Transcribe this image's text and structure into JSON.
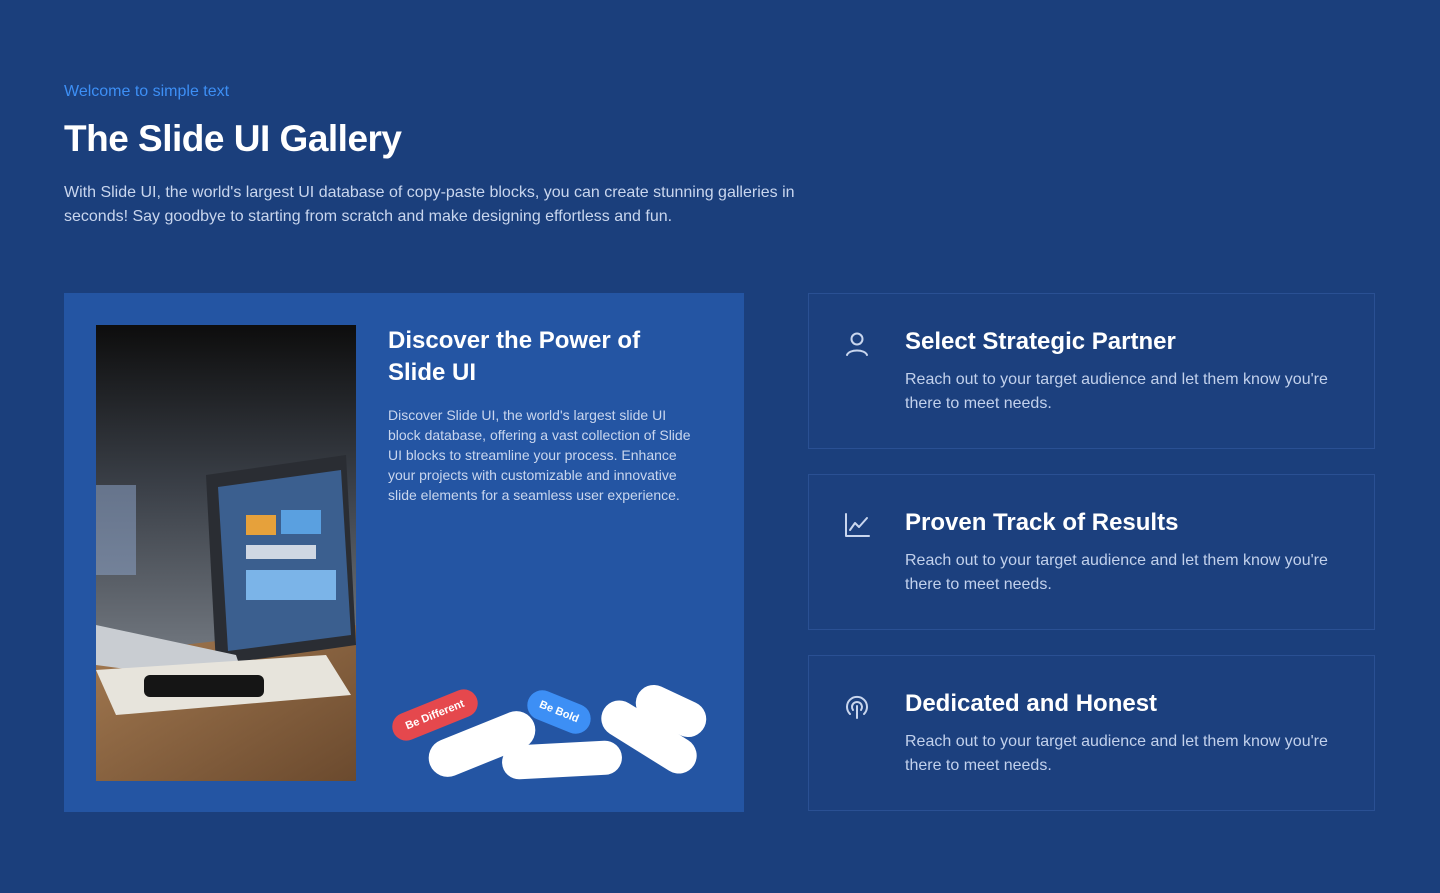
{
  "header": {
    "eyebrow": "Welcome to simple text",
    "title": "The Slide UI Gallery",
    "intro": "With Slide UI, the world's largest UI database of copy-paste blocks, you can create stunning galleries in seconds! Say goodbye to starting from scratch and make designing effortless and fun."
  },
  "hero": {
    "title": "Discover the Power of Slide UI",
    "text": "Discover Slide UI, the world's largest slide UI block database, offering a vast collection of Slide UI blocks to streamline your process. Enhance your projects with customizable and innovative slide elements for a seamless user experience.",
    "tags": [
      "Be Different",
      "Be Bold"
    ]
  },
  "features": [
    {
      "icon": "user-icon",
      "title": "Select Strategic Partner",
      "text": "Reach out to your target audience and let them know you're there to meet needs."
    },
    {
      "icon": "line-chart-icon",
      "title": "Proven Track of Results",
      "text": "Reach out to your target audience and let them know you're there to meet needs."
    },
    {
      "icon": "signal-icon",
      "title": "Dedicated and Honest",
      "text": "Reach out to your target audience and let them know you're there to meet needs."
    }
  ],
  "colors": {
    "background": "#1b3f7c",
    "accent": "#3d8ff5",
    "hero_card": "#2455a3",
    "tag_red": "#e5484d",
    "tag_blue": "#3d8ff5"
  }
}
